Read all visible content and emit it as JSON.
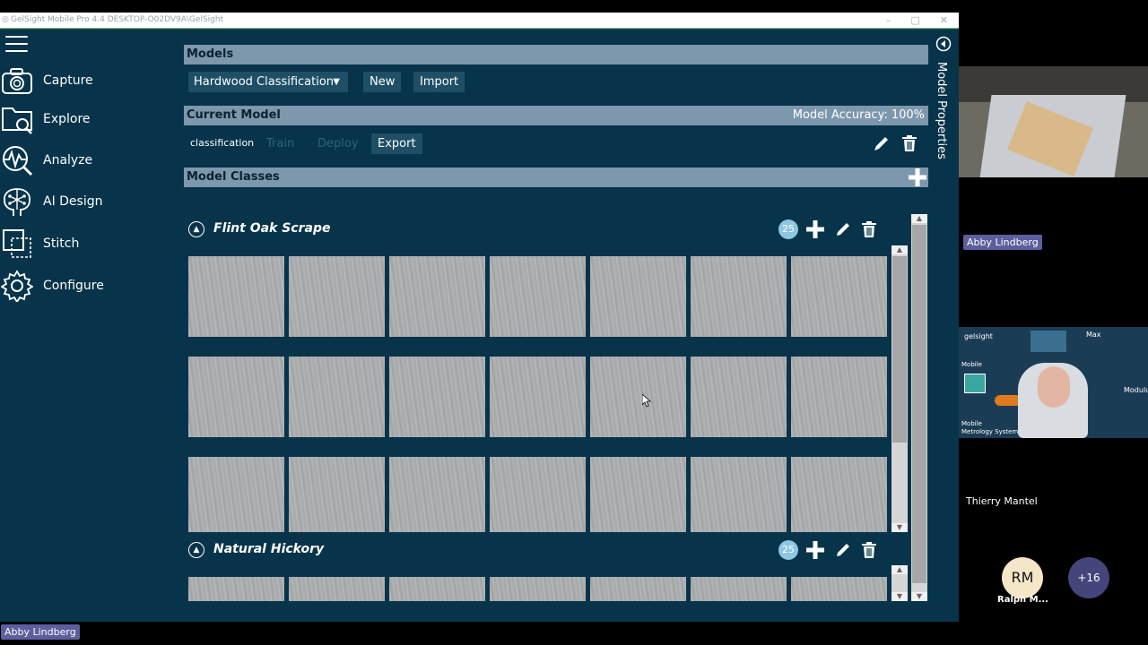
{
  "window": {
    "title": "GelSight Mobile Pro 4.4   DESKTOP-O02DV9A\\GelSight",
    "controls": [
      "–",
      "▢",
      "✕"
    ]
  },
  "sidebar": {
    "items": [
      {
        "label": "Capture",
        "icon": "camera-icon"
      },
      {
        "label": "Explore",
        "icon": "folder-search-icon"
      },
      {
        "label": "Analyze",
        "icon": "waveform-magnifier-icon"
      },
      {
        "label": "AI Design",
        "icon": "brain-icon"
      },
      {
        "label": "Stitch",
        "icon": "stitch-icon"
      },
      {
        "label": "Configure",
        "icon": "gear-icon"
      }
    ]
  },
  "models": {
    "header": "Models",
    "selected": "Hardwood Classification",
    "new_label": "New",
    "import_label": "Import"
  },
  "current_model": {
    "header": "Current Model",
    "accuracy": "Model Accuracy: 100%",
    "name": "classification",
    "train_label": "Train",
    "deploy_label": "Deploy",
    "export_label": "Export"
  },
  "model_classes": {
    "header": "Model Classes",
    "classes": [
      {
        "name": "Flint Oak Scrape",
        "count": "25"
      },
      {
        "name": "Natural Hickory",
        "count": "25"
      }
    ]
  },
  "side_panel": {
    "label": "Model Properties"
  },
  "meeting": {
    "participants": [
      {
        "name": "Abby Lindberg"
      },
      {
        "name": "Thierry Mantel"
      },
      {
        "name": "Ralph M...",
        "initials": "RM"
      }
    ],
    "more_count": "+16",
    "self_tag": "Abby Lindberg",
    "slide": {
      "brand": "gelsight",
      "labels": [
        "Max",
        "Mobile",
        "Modulus",
        "Mobile",
        "Metrology Systems"
      ]
    }
  },
  "colors": {
    "app_bg": "#07344a",
    "header_bar": "#7d97ad",
    "button_bg": "#1e4f66",
    "count_badge": "#8dc7e3",
    "name_tag": "#5c5e9e"
  }
}
